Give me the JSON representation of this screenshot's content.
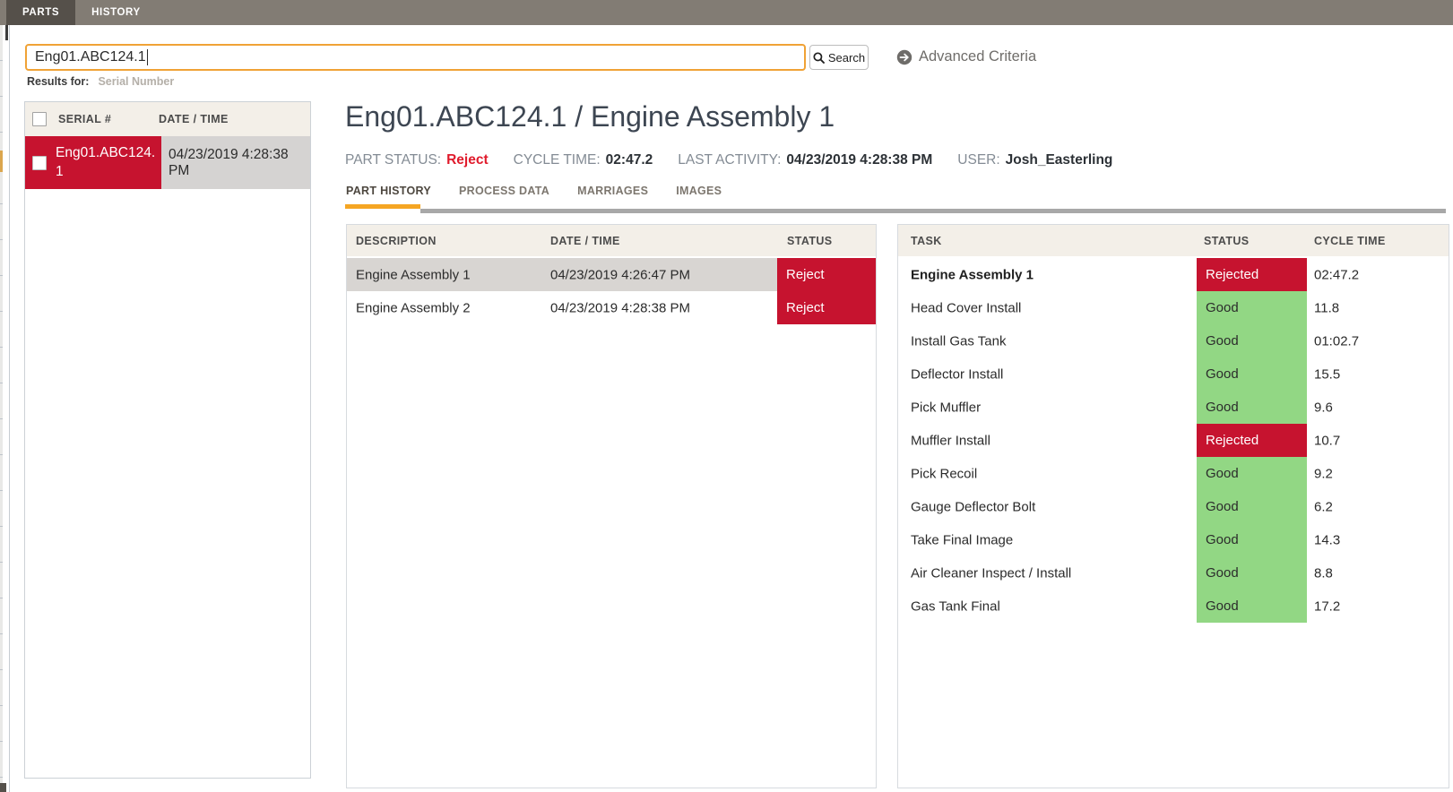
{
  "topbar": {
    "tabs": [
      {
        "label": "PARTS"
      },
      {
        "label": "HISTORY"
      }
    ]
  },
  "search": {
    "value": "Eng01.ABC124.1",
    "button_label": "Search",
    "advanced_label": "Advanced Criteria",
    "results_for_label": "Results for:",
    "results_for_value": "Serial Number"
  },
  "results_panel": {
    "headers": {
      "serial": "SERIAL #",
      "datetime": "DATE / TIME"
    },
    "rows": [
      {
        "serial": "Eng01.ABC124.1",
        "datetime": "04/23/2019 4:28:38 PM"
      }
    ]
  },
  "detail": {
    "title": "Eng01.ABC124.1 / Engine Assembly 1",
    "meta": {
      "part_status_label": "PART STATUS:",
      "part_status": "Reject",
      "cycle_time_label": "CYCLE TIME:",
      "cycle_time": "02:47.2",
      "last_activity_label": "LAST ACTIVITY:",
      "last_activity": "04/23/2019 4:28:38 PM",
      "user_label": "USER:",
      "user": "Josh_Easterling"
    },
    "tabs": [
      {
        "label": "PART HISTORY"
      },
      {
        "label": "PROCESS DATA"
      },
      {
        "label": "MARRIAGES"
      },
      {
        "label": "IMAGES"
      }
    ]
  },
  "history_table": {
    "headers": {
      "description": "DESCRIPTION",
      "datetime": "DATE / TIME",
      "status": "STATUS"
    },
    "rows": [
      {
        "description": "Engine Assembly 1",
        "datetime": "04/23/2019 4:26:47 PM",
        "status": "Reject"
      },
      {
        "description": "Engine Assembly 2",
        "datetime": "04/23/2019 4:28:38 PM",
        "status": "Reject"
      }
    ]
  },
  "task_table": {
    "headers": {
      "task": "TASK",
      "status": "STATUS",
      "cycle": "CYCLE TIME"
    },
    "rows": [
      {
        "task": "Engine Assembly 1",
        "status": "Rejected",
        "cycle": "02:47.2"
      },
      {
        "task": "Head Cover Install",
        "status": "Good",
        "cycle": "11.8"
      },
      {
        "task": "Install Gas Tank",
        "status": "Good",
        "cycle": "01:02.7"
      },
      {
        "task": "Deflector Install",
        "status": "Good",
        "cycle": "15.5"
      },
      {
        "task": "Pick Muffler",
        "status": "Good",
        "cycle": "9.6"
      },
      {
        "task": "Muffler Install",
        "status": "Rejected",
        "cycle": "10.7"
      },
      {
        "task": "Pick Recoil",
        "status": "Good",
        "cycle": "9.2"
      },
      {
        "task": "Gauge Deflector Bolt",
        "status": "Good",
        "cycle": "6.2"
      },
      {
        "task": "Take Final Image",
        "status": "Good",
        "cycle": "14.3"
      },
      {
        "task": "Air Cleaner Inspect / Install",
        "status": "Good",
        "cycle": "8.8"
      },
      {
        "task": "Gas Tank Final",
        "status": "Good",
        "cycle": "17.2"
      }
    ]
  },
  "colors": {
    "reject_red": "#c6132f",
    "good_green": "#92d784",
    "accent_orange": "#f5a623",
    "topbar_gray": "#827c74",
    "header_beige": "#f3efe8"
  }
}
